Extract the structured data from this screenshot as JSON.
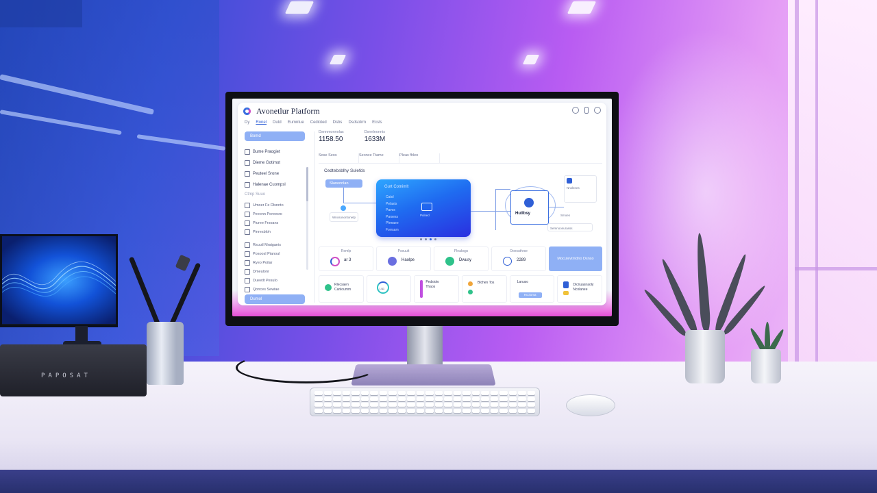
{
  "app": {
    "title": "Avonetlur Platform",
    "nav_tabs": [
      "Dy",
      "Ronel",
      "Dutd",
      "Eumntue",
      "Cedioted",
      "Dsbs",
      "Dsdsotrm",
      "Ecsls"
    ],
    "active_tab_index": 1
  },
  "sidebar": {
    "active_item": "Bomd",
    "items": [
      "Bume Praogiet",
      "Dieme Gotimot",
      "Peuteel Srone",
      "Halenae Cuompsl"
    ],
    "group_label": "Ctmp Suuo",
    "items2": [
      "Umoer Fe Dlsnnto",
      "Peeonn Poreesro",
      "Piuree Frsoans",
      "Pinresbloh"
    ],
    "items3": [
      "Rsuutl Mraiganis",
      "Posoosl Pianoul",
      "Ryeo Poilar",
      "Dmeulonr",
      "Dueetlt Pesulo",
      "Qonces Sewiae"
    ],
    "bottom_button": "Dumol"
  },
  "stats": [
    {
      "label": "Dsnnmonnolas",
      "value": "1158.50"
    },
    {
      "label": "Dsnnlnonnis",
      "value": "1633M"
    }
  ],
  "filters": [
    "Sose Seos",
    "Seonce Ttame",
    "Pleas fhleo"
  ],
  "canvas": {
    "title": "Cedtebsblhy Sulefds",
    "left_button": "Slanennlan",
    "lower_label": "Wnosonontonetp",
    "node_title": "Gurt Cotnimlt",
    "node_items": [
      "Catol",
      "Pelasts",
      "Pavos",
      "Parsess",
      "Phmaee",
      "Forrsam"
    ],
    "node_sub": "Pulsed",
    "hub_label": "Hutlbsy",
    "right_card_text": "Nnslenes",
    "right_card2_text": "Smoes",
    "right_card3_text": "Semnoonurasss",
    "pager_active": 2
  },
  "cards": [
    {
      "title": "Remlp",
      "value": "ar 3"
    },
    {
      "title": "Psouult",
      "value": "Haolpe"
    },
    {
      "title": "Pleaksgs",
      "value": "Dwusy"
    },
    {
      "title": "Ooesuthrse",
      "value": "2289"
    },
    {
      "title": "",
      "value": "Mocutevtmdno Dsnso"
    }
  ],
  "cards2": [
    {
      "text": "Rlecsaen\nCanloumm"
    },
    {
      "text": "1/11"
    },
    {
      "text": "Pedsioto\nThaos"
    },
    {
      "text": "Blchen Tos"
    },
    {
      "text": "Lanuso",
      "button": "Hcoioma"
    },
    {
      "text": "Dicnuasnaoly\nNcolanee"
    }
  ],
  "device_label": "PAPOSAT",
  "colors": {
    "accent": "#2f5fd6",
    "soft_accent": "#8fb0f5",
    "magenta": "#e54fd6",
    "node_blue": "#1f6bf0"
  }
}
